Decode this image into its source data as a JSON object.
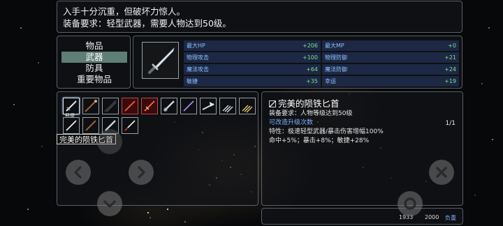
{
  "description": {
    "line1": "入手十分沉重，但破坏力惊人。",
    "line2": "装备要求：轻型武器，需要人物达到50级。"
  },
  "categories": {
    "items": [
      "物品",
      "武器",
      "防具",
      "重要物品"
    ],
    "active_index": 1
  },
  "stats": {
    "max_hp_label": "最大HP",
    "max_hp_value": "+206",
    "max_mp_label": "最大MP",
    "max_mp_value": "+0",
    "phys_atk_label": "物理攻击",
    "phys_atk_value": "+100",
    "phys_def_label": "物理防御",
    "phys_def_value": "+21",
    "mag_atk_label": "魔法攻击",
    "mag_atk_value": "+64",
    "mag_def_label": "魔法防御",
    "mag_def_value": "+24",
    "agi_label": "敏捷",
    "agi_value": "+35",
    "luck_label": "幸运",
    "luck_value": "+19"
  },
  "inventory": {
    "first_slot_tag": "熊傻蜂",
    "tooltip": "完美的陨铁匕首",
    "slot_icons": [
      "dagger-icon",
      "staff-icon",
      "bow-icon",
      "red-blade-icon",
      "red-blade-icon",
      "sword-icon",
      "sword-icon",
      "axe-icon",
      "claw-icon",
      "claw-icon",
      "sword-icon",
      "dagger-icon",
      "dagger-icon",
      "dagger-icon"
    ]
  },
  "detail": {
    "title": "完美的陨铁匕首",
    "requirement": "装备要求：人物等级达到50级",
    "upgrade": "可改造升级次数",
    "page": "1/1",
    "trait": "特性：极速轻型武器/暴击伤害增幅100%",
    "bonus": "命中+5%；暴击+8%；敏捷+28%"
  },
  "status": {
    "left_value": "1933",
    "right_value": "2000",
    "label": "负重"
  },
  "colors": {
    "active_category_bg": "#5f7e74",
    "stat_label": "#8fc0ff",
    "stat_value": "#7fe08f",
    "stat_row_bg": "#28376e",
    "highlight_text": "#7eb0ff"
  }
}
